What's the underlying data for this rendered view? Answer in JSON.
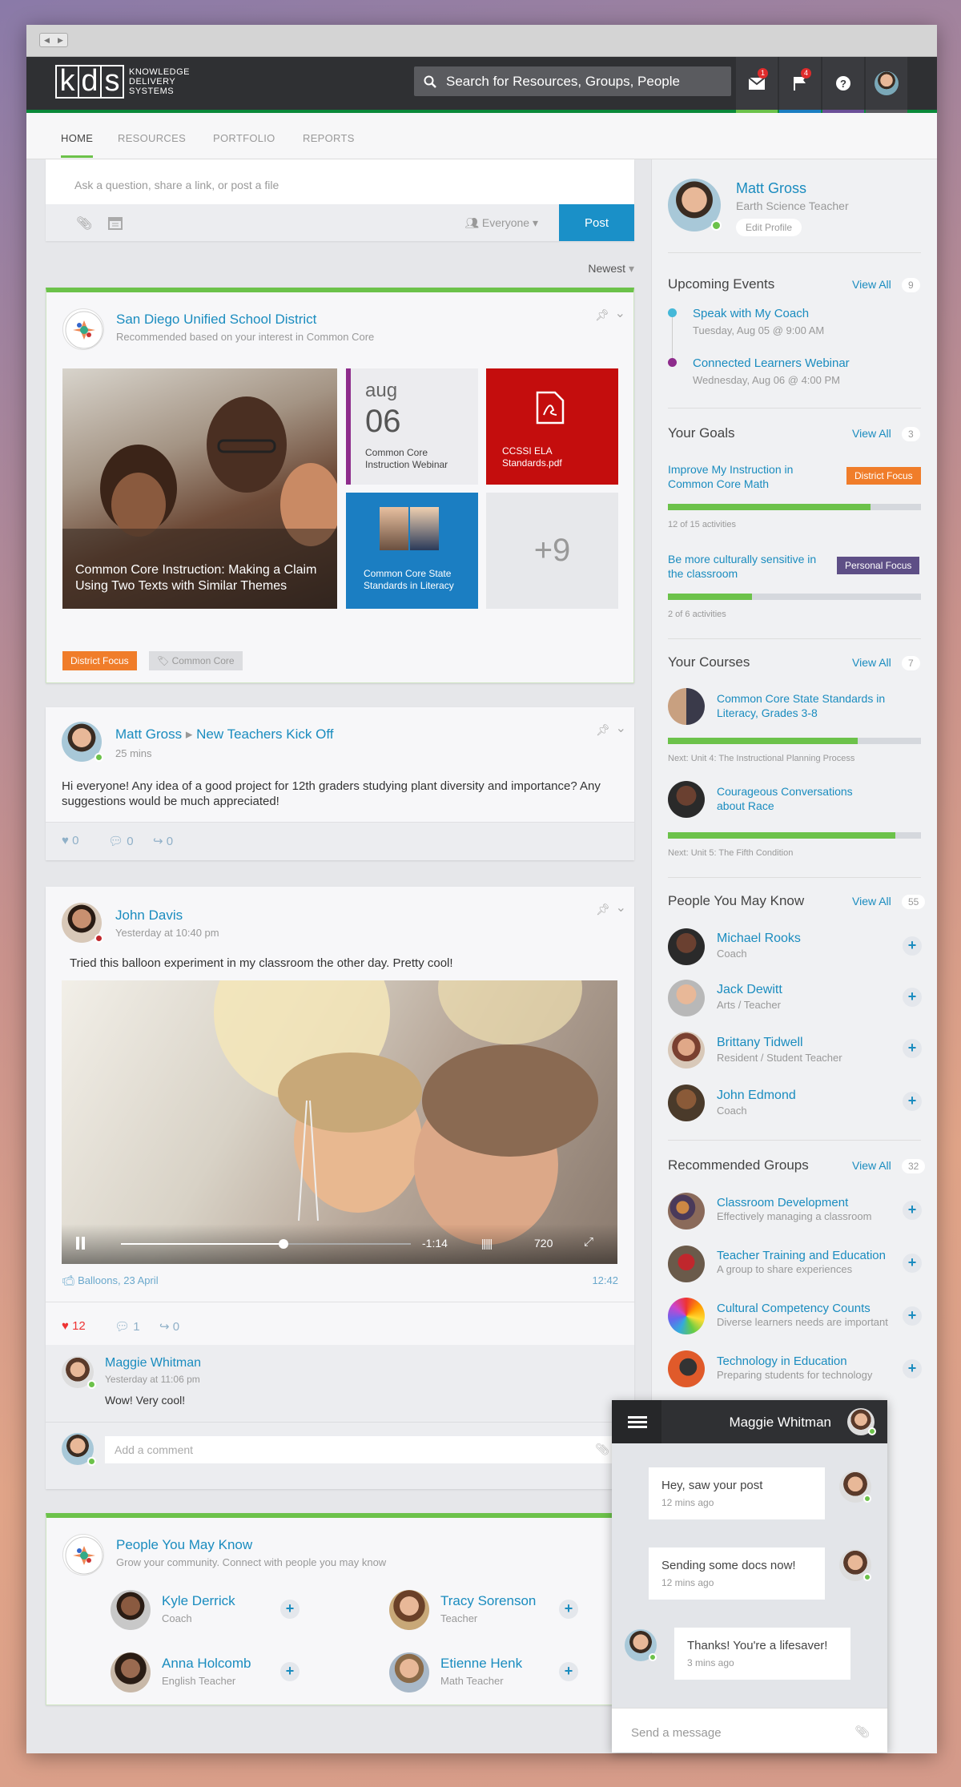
{
  "chrome": {
    "back": "◀",
    "fwd": "▶"
  },
  "brand": {
    "letters": [
      "k",
      "d",
      "s"
    ],
    "line1": "KNOWLEDGE",
    "line2": "DELIVERY",
    "line3": "SYSTEMS"
  },
  "search": {
    "placeholder": "Search for Resources, Groups, People"
  },
  "topbar": {
    "mail_badge": "1",
    "flag_badge": "4"
  },
  "tabs": [
    "HOME",
    "RESOURCES",
    "PORTFOLIO",
    "REPORTS"
  ],
  "composer": {
    "placeholder": "Ask a question, share a link, or post a file",
    "audience": "Everyone",
    "post": "Post"
  },
  "feed": {
    "sort": "Newest"
  },
  "post1": {
    "author": "San Diego Unified School District",
    "sub": "Recommended based on your interest in Common Core",
    "tile_main": "Common Core Instruction: Making a Claim Using Two Texts with Similar Themes",
    "tile_date_month": "aug",
    "tile_date_day": "06",
    "tile_date_label": "Common Core Instruction Webinar",
    "tile_pdf": "CCSSI ELA Standards.pdf",
    "tile_course": "Common Core State Standards in Literacy",
    "tile_more": "+9",
    "tag1": "District Focus",
    "tag2": "Common Core"
  },
  "post2": {
    "author": "Matt Gross",
    "arrow": "▸",
    "group": "New Teachers Kick Off",
    "time": "25 mins",
    "body": "Hi everyone! Any idea of a good project for 12th graders studying plant diversity and importance? Any suggestions would be much appreciated!",
    "likes": "0",
    "comments": "0",
    "shares": "0"
  },
  "post3": {
    "author": "John Davis",
    "time": "Yesterday at 10:40 pm",
    "body": "Tried this balloon experiment in my classroom the other day. Pretty cool!",
    "video_remaining": "-1:14",
    "video_quality": "720",
    "video_progress": 0.56,
    "caption": "Balloons, 23 April",
    "duration": "12:42",
    "likes": "12",
    "comments": "1",
    "shares": "0",
    "comment_author": "Maggie Whitman",
    "comment_time": "Yesterday at 11:06 pm",
    "comment_body": "Wow! Very cool!",
    "add_comment": "Add a comment"
  },
  "post4": {
    "title": "People You May Know",
    "sub": "Grow your community. Connect with people you may know",
    "people": [
      {
        "name": "Kyle Derrick",
        "role": "Coach"
      },
      {
        "name": "Tracy Sorenson",
        "role": "Teacher"
      },
      {
        "name": "Anna Holcomb",
        "role": "English Teacher"
      },
      {
        "name": "Etienne Henk",
        "role": "Math Teacher"
      }
    ]
  },
  "profile": {
    "name": "Matt Gross",
    "role": "Earth Science Teacher",
    "edit": "Edit Profile"
  },
  "events": {
    "title": "Upcoming Events",
    "viewall": "View All",
    "count": "9",
    "items": [
      {
        "title": "Speak with My Coach",
        "when": "Tuesday, Aug 05 @ 9:00 AM"
      },
      {
        "title": "Connected Learners Webinar",
        "when": "Wednesday, Aug 06 @ 4:00 PM"
      }
    ]
  },
  "goals": {
    "title": "Your Goals",
    "viewall": "View All",
    "count": "3",
    "items": [
      {
        "title": "Improve My Instruction in Common Core Math",
        "tag": "District Focus",
        "progress": 0.8,
        "status": "12 of 15 activities"
      },
      {
        "title": "Be more culturally sensitive in the classroom",
        "tag": "Personal Focus",
        "progress": 0.333,
        "status": "2 of 6 activities"
      }
    ]
  },
  "courses": {
    "title": "Your Courses",
    "viewall": "View All",
    "count": "7",
    "items": [
      {
        "title": "Common Core State Standards in Literacy, Grades 3-8",
        "progress": 0.75,
        "next": "Next: Unit 4: The Instructional Planning Process"
      },
      {
        "title": "Courageous Conversations about Race",
        "progress": 0.9,
        "next": "Next: Unit 5: The Fifth Condition"
      }
    ]
  },
  "people": {
    "title": "People You May Know",
    "viewall": "View All",
    "count": "55",
    "items": [
      {
        "name": "Michael Rooks",
        "role": "Coach"
      },
      {
        "name": "Jack Dewitt",
        "role": "Arts / Teacher"
      },
      {
        "name": "Brittany Tidwell",
        "role": "Resident / Student Teacher"
      },
      {
        "name": "John Edmond",
        "role": "Coach"
      }
    ]
  },
  "groups": {
    "title": "Recommended Groups",
    "viewall": "View All",
    "count": "32",
    "items": [
      {
        "name": "Classroom Development",
        "desc": "Effectively managing a classroom"
      },
      {
        "name": "Teacher Training and Education",
        "desc": "A group to share experiences"
      },
      {
        "name": "Cultural Competency Counts",
        "desc": "Diverse learners needs are important"
      },
      {
        "name": "Technology in Education",
        "desc": "Preparing students for technology"
      }
    ]
  },
  "chat": {
    "name": "Maggie Whitman",
    "messages": [
      {
        "text": "Hey, saw your post",
        "time": "12 mins ago"
      },
      {
        "text": "Sending some docs now!",
        "time": "12 mins ago"
      },
      {
        "text": "Thanks! You're a lifesaver!",
        "time": "3 mins ago"
      }
    ],
    "placeholder": "Send a message"
  },
  "colors": {
    "accent": "#1a8cbf",
    "green": "#6cc24a",
    "topbar": "#2f3033",
    "district": "#f07d2a",
    "personal": "#5e4f86",
    "pdf": "#c40d0d",
    "course": "#1b7ec2"
  }
}
